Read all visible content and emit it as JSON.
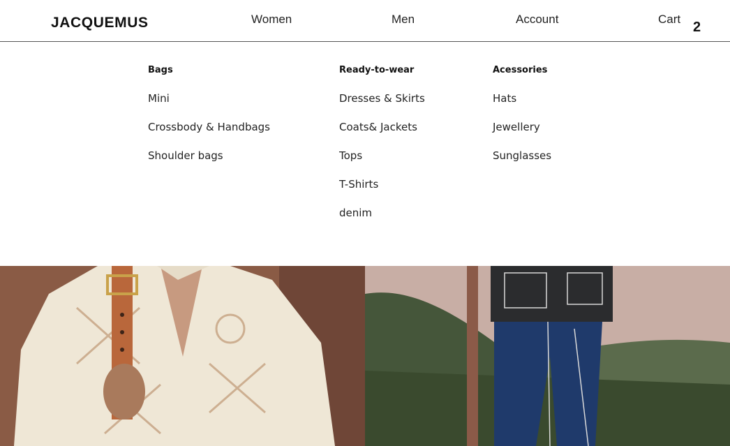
{
  "header": {
    "logo": "JACQUEMUS",
    "nav": {
      "women": "Women",
      "men": "Men",
      "account": "Account",
      "cart": "Cart"
    },
    "cart_count": "2"
  },
  "menu": {
    "columns": [
      {
        "title": "Bags",
        "items": [
          "Mini",
          "Crossbody & Handbags",
          "Shoulder bags"
        ]
      },
      {
        "title": "Ready-to-wear",
        "items": [
          "Dresses & Skirts",
          "Coats& Jackets",
          "Tops",
          "T-Shirts",
          "denim"
        ]
      },
      {
        "title": "Acessories",
        "items": [
          "Hats",
          "Jewellery",
          "Sunglasses"
        ]
      }
    ]
  }
}
